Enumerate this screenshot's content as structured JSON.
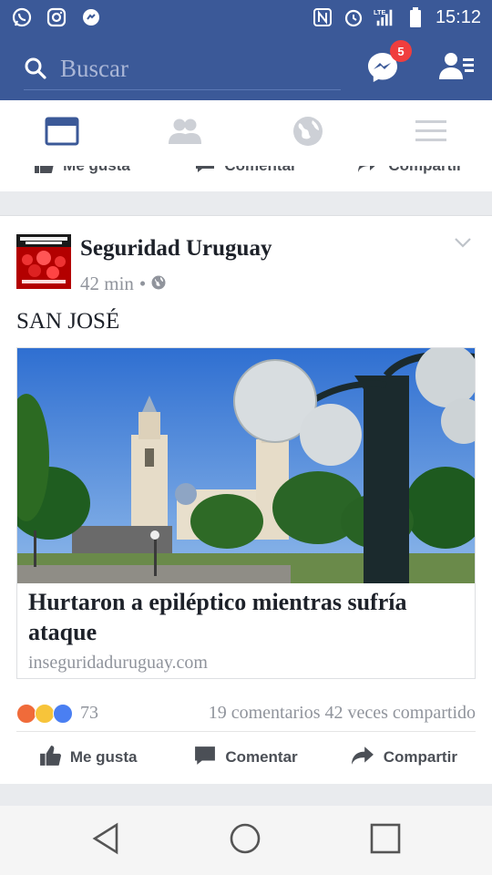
{
  "status_bar": {
    "time": "15:12",
    "network": "LTE",
    "left_icons": [
      "whatsapp-icon",
      "instagram-icon",
      "messenger-alt-icon"
    ],
    "right_icons": [
      "nfc-icon",
      "alarm-icon",
      "signal-icon",
      "battery-icon"
    ]
  },
  "top_bar": {
    "search_placeholder": "Buscar",
    "messenger_badge": "5"
  },
  "tabs": [
    {
      "name": "news-feed",
      "active": true
    },
    {
      "name": "friends",
      "active": false
    },
    {
      "name": "notifications-globe",
      "active": false
    },
    {
      "name": "menu",
      "active": false
    }
  ],
  "prev_post_actions": {
    "like": "Me gusta",
    "comment": "Comentar",
    "share": "Compartir"
  },
  "post": {
    "page_name": "Seguridad Uruguay",
    "time": "42 min",
    "separator": "•",
    "text": "SAN JOSÉ",
    "link": {
      "title": "Hurtaron a epiléptico mientras sufría ataque",
      "domain": "inseguridaduruguay.com"
    },
    "reactions": {
      "count": "73",
      "comments": "19 comentarios",
      "shares": "42 veces compartido"
    },
    "actions": {
      "like": "Me gusta",
      "comment": "Comentar",
      "share": "Compartir"
    }
  },
  "colors": {
    "brand": "#3b5998",
    "badge": "#f03e3e",
    "feed_bg": "#e9ebee"
  }
}
